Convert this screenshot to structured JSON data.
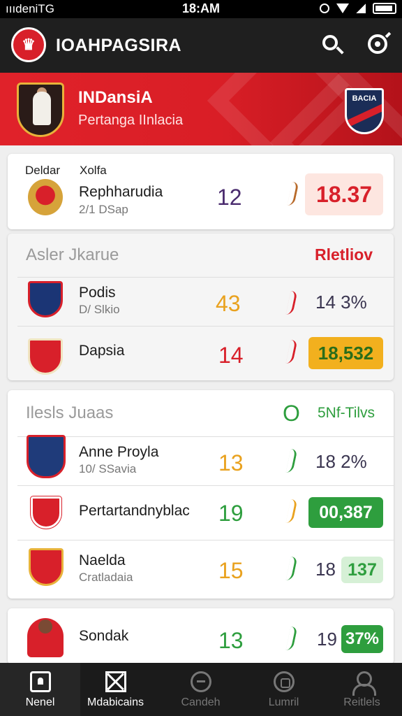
{
  "status_bar": {
    "carrier": "ıııdeniTG",
    "time": "18:AM"
  },
  "app_bar": {
    "title": "IOAHPAGSIRA"
  },
  "hero": {
    "title": "INDansiA",
    "subtitle": "Pertanga IInlacia",
    "badge_text": "BACIA"
  },
  "featured": {
    "label_left": "Deldar",
    "label_right": "Xolfa",
    "team": "Rephharudia",
    "sub": "2/1 DSap",
    "score": "12",
    "value": "18.37"
  },
  "section1": {
    "title": "Asler Jkarue",
    "action": "Rletliov",
    "rows": [
      {
        "team": "Podis",
        "sub": "D/ Slkio",
        "score": "43",
        "score_color": "#e9a21f",
        "trend_color": "#d8202a",
        "pct": "14 3%",
        "value": ""
      },
      {
        "team": "Dapsia",
        "sub": "",
        "score": "14",
        "score_color": "#d8202a",
        "trend_color": "#d8202a",
        "pct": "",
        "value": "18,532"
      }
    ]
  },
  "section2": {
    "title": "Ilesls Juaas",
    "mid": "O",
    "action": "5Nf‑Tilvs",
    "rows": [
      {
        "team": "Anne Proyla",
        "sub": "10/ SSavia",
        "score": "13",
        "score_color": "#e9a21f",
        "trend_color": "#2e9e3e",
        "pct": "18 2%",
        "value": ""
      },
      {
        "team": "Pertartandnyblac",
        "sub": "",
        "score": "19",
        "score_color": "#2e9e3e",
        "trend_color": "#e9a21f",
        "pct": "",
        "value": "00,387"
      },
      {
        "team": "Naelda",
        "sub": "Cratladaia",
        "score": "15",
        "score_color": "#e9a21f",
        "trend_color": "#2e9e3e",
        "pct": "18",
        "value": "137"
      }
    ]
  },
  "last_row": {
    "team": "Sondak",
    "score": "13",
    "pct": "19",
    "value": "37%"
  },
  "nav": {
    "items": [
      {
        "label": "Nenel"
      },
      {
        "label": "Mdabicains"
      },
      {
        "label": "Candeh"
      },
      {
        "label": "Lumril"
      },
      {
        "label": "Reitlels"
      }
    ]
  },
  "colors": {
    "brand_red": "#d8202a",
    "accent_green": "#2e9e3e",
    "accent_gold": "#e9a21f",
    "dark": "#1f1f1f"
  }
}
